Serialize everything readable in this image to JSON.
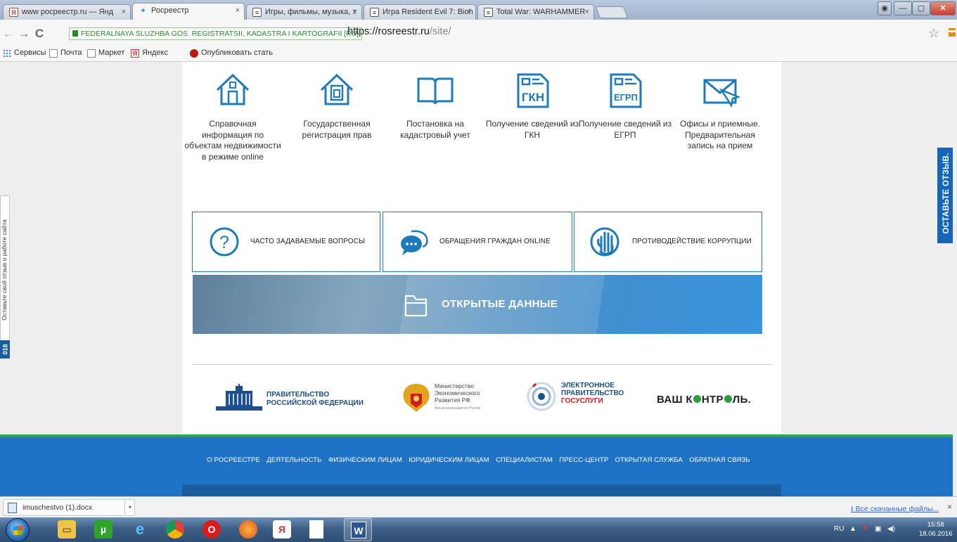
{
  "browser": {
    "tabs": [
      {
        "label": "www росреестр.ru — Янд",
        "favicon": "yandex-favicon",
        "active": false
      },
      {
        "label": "Росреестр",
        "favicon": "rosreestr-favicon",
        "active": true
      },
      {
        "label": "Игры, фильмы, музыка, т",
        "favicon": "page-favicon",
        "active": false
      },
      {
        "label": "Игра Resident Evil 7: Bioh",
        "favicon": "page-favicon",
        "active": false
      },
      {
        "label": "Total War: WARHAMMER",
        "favicon": "page-favicon",
        "active": false
      }
    ],
    "tab_close": "×",
    "security_label": "FEDERALNAYA SLUZHBA GOS. REGISTRATSII, KADASTRA I KARTOGRAFII [RU]",
    "url_scheme": "https://",
    "url_host": "rosreestr.ru",
    "url_path": "/site/",
    "bookmarks": [
      "Сервисы",
      "Почта",
      "Маркет",
      "Яндекс",
      "Опубликовать стать"
    ]
  },
  "services": [
    {
      "label": "Справочная информация по объектам недвижимости в режиме online",
      "icon": "house-icon"
    },
    {
      "label": "Государственная регистрация прав",
      "icon": "house-document-icon"
    },
    {
      "label": "Постановка на кадастровый учет",
      "icon": "open-book-icon"
    },
    {
      "label": "Получение сведений из ГКН",
      "icon": "gkn-document-icon",
      "icon_text": "ГКН"
    },
    {
      "label": "Получение сведений из ЕГРП",
      "icon": "egrp-document-icon",
      "icon_text": "ЕГРП"
    },
    {
      "label": "Офисы и приемные. Предварительная запись на прием",
      "icon": "envelope-cursor-icon"
    }
  ],
  "quick_links": [
    {
      "label": "ЧАСТО ЗАДАВАЕМЫЕ ВОПРОСЫ",
      "icon": "question-circle-icon"
    },
    {
      "label": "ОБРАЩЕНИЯ ГРАЖДАН ONLINE",
      "icon": "chat-bubbles-icon"
    },
    {
      "label": "ПРОТИВОДЕЙСТВИЕ КОРРУПЦИИ",
      "icon": "stop-hand-icon"
    }
  ],
  "open_data": {
    "label": "ОТКРЫТЫЕ ДАННЫЕ",
    "icon": "folder-icon"
  },
  "partners": {
    "gov": {
      "line1": "ПРАВИТЕЛЬСТВО",
      "line2": "РОССИЙСКОЙ ФЕДЕРАЦИИ"
    },
    "econ": {
      "line1": "Министерство",
      "line2": "Экономического",
      "line3": "Развития РФ",
      "sub": "Минэкономразвития России"
    },
    "egov": {
      "line1": "ЭЛЕКТРОННОЕ",
      "line2": "ПРАВИТЕЛЬСТВО",
      "line3": "ГОСУСЛУГИ"
    },
    "vk": {
      "part1": "ВАШ",
      "part2": "К",
      "part3": "НТР",
      "part4": "ЛЬ."
    }
  },
  "footer_nav": [
    "О РОСРЕЕСТРЕ",
    "ДЕЯТЕЛЬНОСТЬ",
    "ФИЗИЧЕСКИМ ЛИЦАМ",
    "ЮРИДИЧЕСКИМ ЛИЦАМ",
    "СПЕЦИАЛИСТАМ",
    "ПРЕСС-ЦЕНТР",
    "ОТКРЫТАЯ СЛУЖБА",
    "ОБРАТНАЯ СВЯЗЬ"
  ],
  "feedback_left": {
    "text": "Оставьте свой отзыв о работе сайта",
    "number": "018"
  },
  "feedback_right": "ОСТАВЬТЕ ОТЗЫВ.",
  "download_shelf": {
    "file": "imuschestvo (1).docx",
    "all_downloads": "Все скачанные файлы...",
    "close": "×"
  },
  "taskbar": {
    "lang": "RU",
    "time": "15:58",
    "date": "18.06.2016"
  },
  "colors": {
    "brand_blue": "#1f73c6",
    "accent_green": "#2aa74b",
    "icon_blue": "#1e7ab8"
  }
}
